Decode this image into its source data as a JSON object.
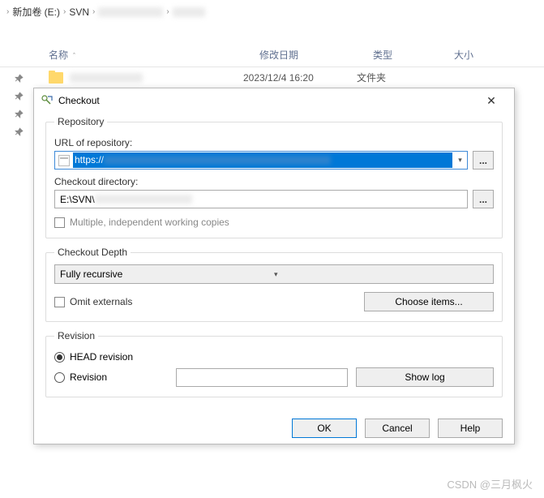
{
  "breadcrumb": {
    "drive": "新加卷 (E:)",
    "folder": "SVN"
  },
  "columns": {
    "name": "名称",
    "date": "修改日期",
    "type": "类型",
    "size": "大小"
  },
  "file": {
    "date": "2023/12/4 16:20",
    "type": "文件夹"
  },
  "dialog": {
    "title": "Checkout",
    "repository": {
      "legend": "Repository",
      "url_label": "URL of repository:",
      "url_value": "https://",
      "dir_label": "Checkout directory:",
      "dir_value": "E:\\SVN\\",
      "browse": "...",
      "multi_label": "Multiple, independent working copies"
    },
    "depth": {
      "legend": "Checkout Depth",
      "value": "Fully recursive",
      "omit_label": "Omit externals",
      "choose_label": "Choose items..."
    },
    "revision": {
      "legend": "Revision",
      "head_label": "HEAD revision",
      "rev_label": "Revision",
      "showlog_label": "Show log"
    },
    "buttons": {
      "ok": "OK",
      "cancel": "Cancel",
      "help": "Help"
    }
  },
  "watermark": "CSDN @三月枫火"
}
